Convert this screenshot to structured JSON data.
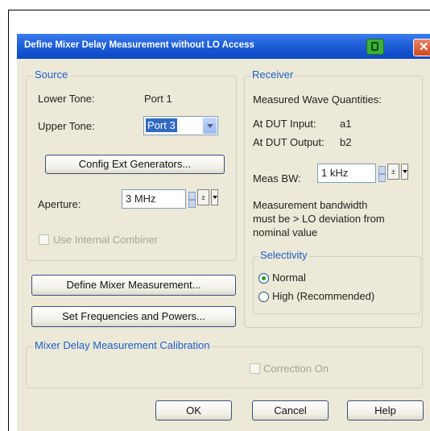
{
  "dialog": {
    "title": "Define Mixer Delay Measurement without LO Access"
  },
  "source": {
    "label": "Source",
    "lower_tone_label": "Lower Tone:",
    "lower_tone_value": "Port 1",
    "upper_tone_label": "Upper Tone:",
    "upper_tone_value": "Port 3",
    "config_ext_button": "Config Ext Generators...",
    "aperture_label": "Aperture:",
    "aperture_value": "3 MHz",
    "use_internal_combiner": "Use Internal Combiner"
  },
  "receiver": {
    "label": "Receiver",
    "measured_wave_label": "Measured Wave Quantities:",
    "dut_input_label": "At DUT Input:",
    "dut_input_value": "a1",
    "dut_output_label": "At DUT Output:",
    "dut_output_value": "b2",
    "meas_bw_label": "Meas BW:",
    "meas_bw_value": "1 kHz",
    "note_line1": "Measurement bandwidth",
    "note_line2": "must be > LO deviation from",
    "note_line3": "nominal value",
    "selectivity_label": "Selectivity",
    "normal_label": "Normal",
    "high_label": "High (Recommended)"
  },
  "actions": {
    "define_mixer_button": "Define Mixer Measurement...",
    "set_freq_button": "Set Frequencies and Powers..."
  },
  "calibration": {
    "label": "Mixer Delay Measurement Calibration",
    "correction_on": "Correction On"
  },
  "footer": {
    "ok": "OK",
    "cancel": "Cancel",
    "help": "Help"
  },
  "icons": {
    "close": "close-icon",
    "title_app": "app-icon",
    "spin": "spin-icon"
  },
  "colors": {
    "accent": "#1c5ec8",
    "title_bar": "#0a47c4"
  }
}
